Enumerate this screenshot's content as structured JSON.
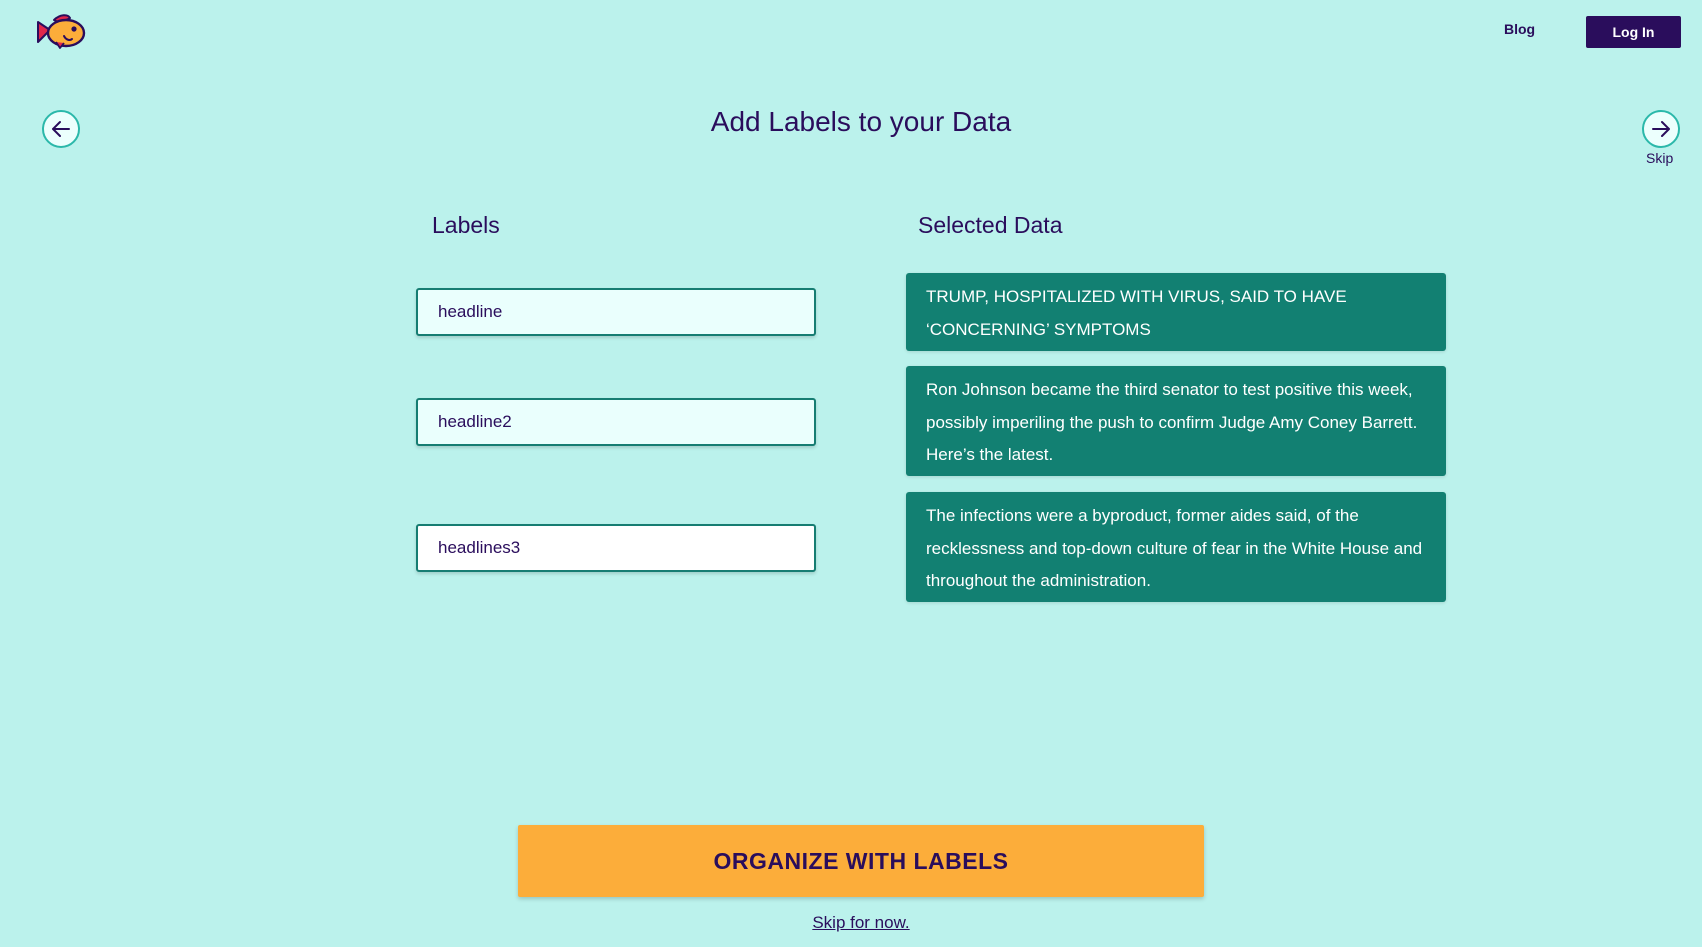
{
  "header": {
    "logo_icon": "fish-logo-icon",
    "blog_label": "Blog",
    "login_label": "Log In"
  },
  "nav": {
    "back_icon": "arrow-left-icon",
    "next_icon": "arrow-right-icon",
    "skip_label": "Skip"
  },
  "main": {
    "title": "Add Labels to your Data",
    "labels_heading": "Labels",
    "data_heading": "Selected Data",
    "labels": [
      {
        "value": "headline"
      },
      {
        "value": "headline2"
      },
      {
        "value": "headlines3"
      }
    ],
    "selected_data": [
      {
        "text": "TRUMP, HOSPITALIZED WITH VIRUS, SAID TO HAVE ‘CONCERNING’ SYMPTOMS"
      },
      {
        "text": "Ron Johnson became the third senator to test positive this week, possibly imperiling the push to confirm Judge Amy Coney Barrett. Here’s the latest."
      },
      {
        "text": "The infections were a byproduct, former aides said, of the recklessness and top-down culture of fear in the White House and throughout the administration."
      }
    ]
  },
  "footer": {
    "organize_label": "ORGANIZE WITH LABELS",
    "skip_link_label": "Skip for now."
  },
  "colors": {
    "background": "#bbf2ec",
    "primary_text": "#2a0d5c",
    "card": "#128072",
    "accent": "#fcad3a"
  }
}
